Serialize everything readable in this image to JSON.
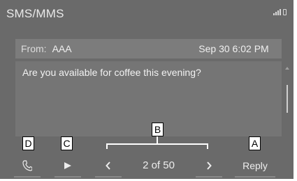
{
  "screen": {
    "title": "SMS/MMS"
  },
  "message": {
    "from_label": "From:",
    "from_value": "AAA",
    "date": "Sep 30  6:02 PM",
    "body": "Are you available for coffee this evening?"
  },
  "buttons": {
    "call_icon": "phone-icon",
    "play_icon": "play-icon",
    "prev_icon": "chevron-left-icon",
    "counter": "2 of 50",
    "next_icon": "chevron-right-icon",
    "reply_label": "Reply"
  },
  "callouts": {
    "a": "A",
    "b": "B",
    "c": "C",
    "d": "D"
  },
  "colors": {
    "screen_bg": "#6a6a6a",
    "field_bg": "#7c7c7c",
    "text": "#ededed"
  }
}
